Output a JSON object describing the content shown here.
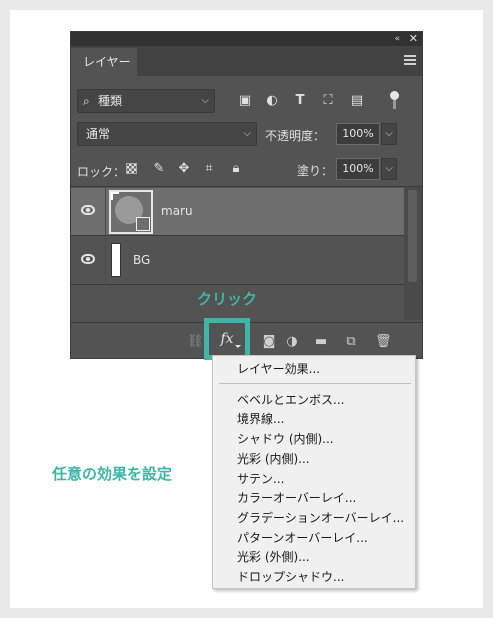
{
  "panel": {
    "tab_label": "レイヤー",
    "title_collapse": "«",
    "title_close": "✕",
    "filter": {
      "label": "種類",
      "icons": [
        "image-filter-icon",
        "adjustment-filter-icon",
        "type-filter-icon",
        "shape-filter-icon",
        "smart-object-filter-icon",
        "filter-toggle-icon"
      ]
    },
    "blend_mode": "通常",
    "opacity_label": "不透明度：",
    "opacity_value": "100%",
    "lock_label": "ロック：",
    "lock_icons": [
      "lock-transparent-icon",
      "lock-image-icon",
      "lock-position-icon",
      "lock-artboard-icon",
      "lock-all-icon"
    ],
    "fill_label": "塗り：",
    "fill_value": "100%",
    "layers": [
      {
        "name": "maru",
        "visible": true,
        "selected": true
      },
      {
        "name": "BG",
        "visible": true,
        "selected": false
      }
    ],
    "bottom_icons": [
      "link-layers-icon",
      "fx-icon",
      "mask-icon",
      "adjustment-icon",
      "folder-icon",
      "new-layer-icon",
      "trash-icon"
    ],
    "fx_label": "fx"
  },
  "annotations": {
    "click": "クリック",
    "side": "任意の効果を設定"
  },
  "menu": {
    "items": [
      "レイヤー効果...",
      "ベベルとエンボス...",
      "境界線...",
      "シャドウ (内側)...",
      "光彩 (内側)...",
      "サテン...",
      "カラーオーバーレイ...",
      "グラデーションオーバーレイ...",
      "パターンオーバーレイ...",
      "光彩 (外側)...",
      "ドロップシャドウ..."
    ]
  },
  "colors": {
    "accent": "#3fb5a7",
    "panel": "#535353",
    "menu": "#f0f0f0"
  }
}
